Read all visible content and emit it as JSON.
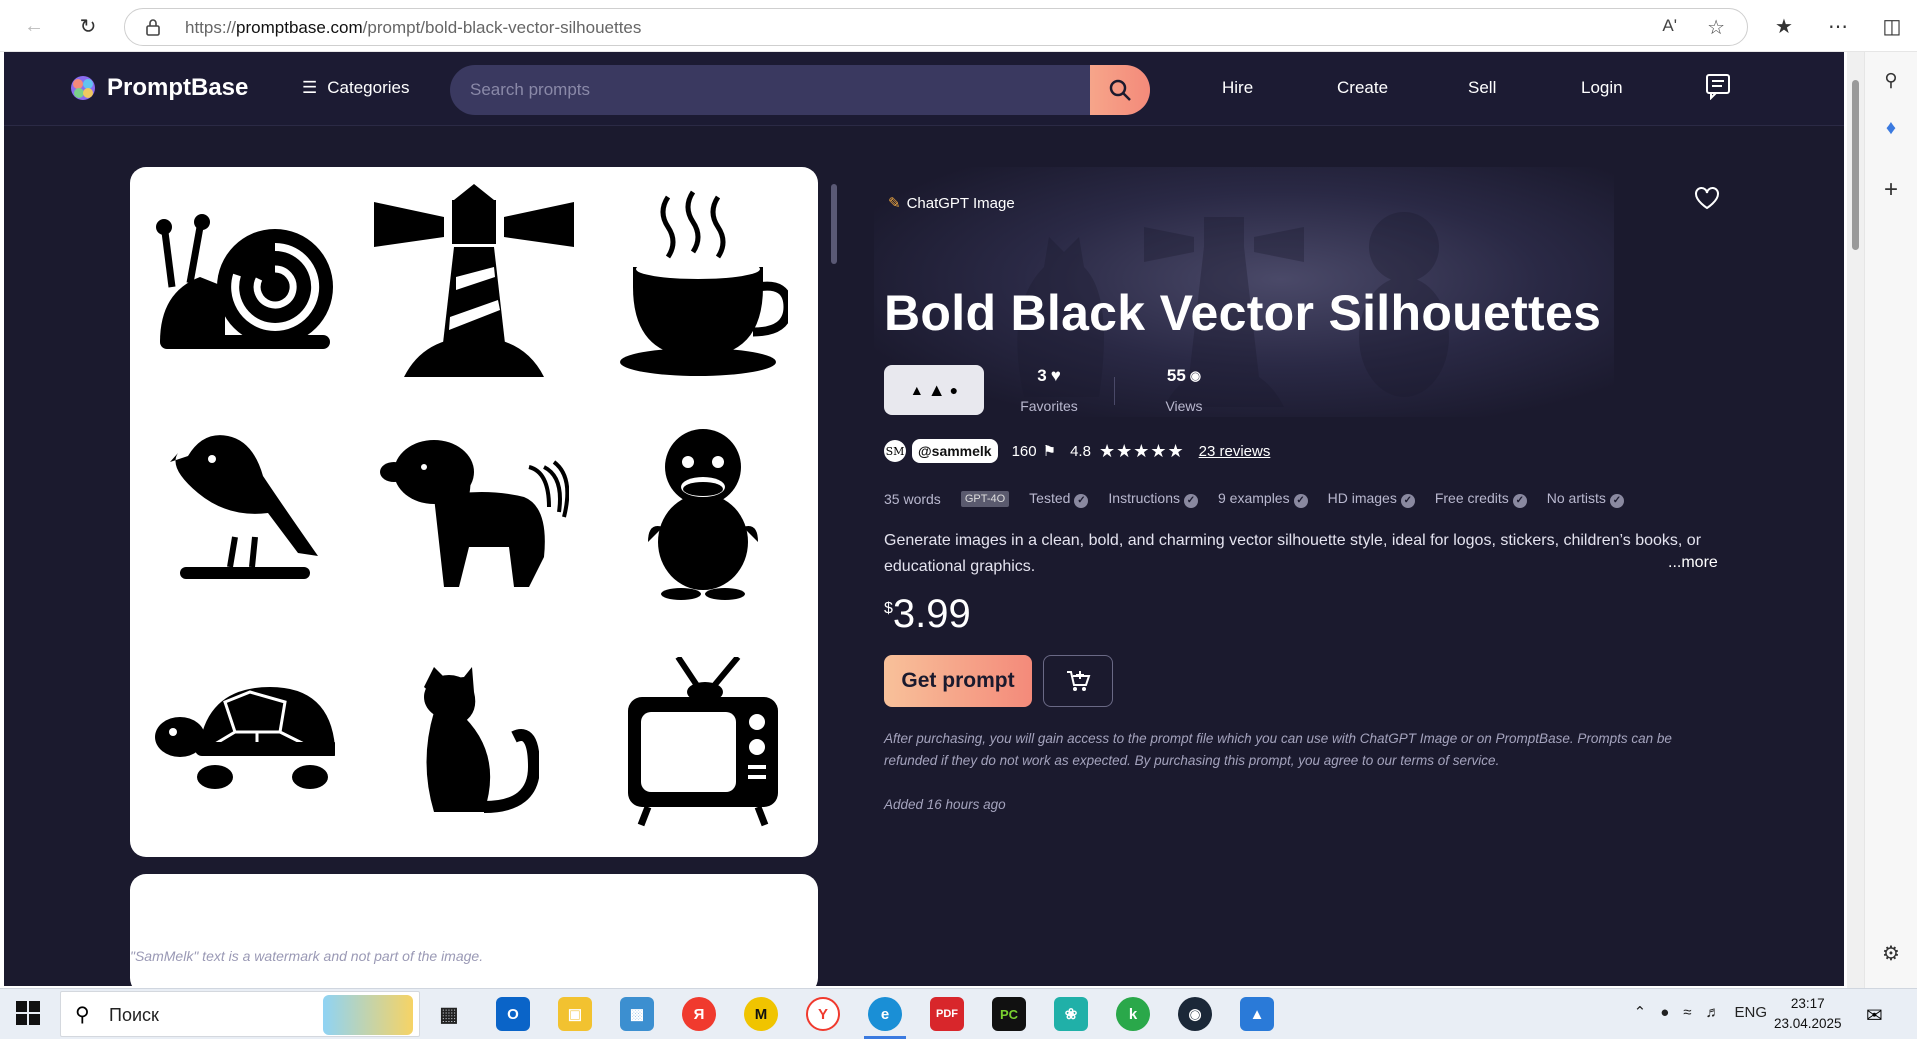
{
  "browser": {
    "url_prefix": "https://",
    "url_domain": "promptbase.com",
    "url_path": "/prompt/bold-black-vector-silhouettes",
    "read_aloud": "Aʹ"
  },
  "nav": {
    "logo_text": "PromptBase",
    "categories_label": "Categories",
    "search_placeholder": "Search prompts",
    "links": [
      "Hire",
      "Create",
      "Sell",
      "Login"
    ]
  },
  "prompt": {
    "model_badge": "ChatGPT Image",
    "title": "Bold Black Vector Silhouettes",
    "favorites_count": "3",
    "favorites_label": "Favorites",
    "views_count": "55",
    "views_label": "Views",
    "author_handle": "@sammelk",
    "author_initials": "SM",
    "author_sales": "160",
    "rating": "4.8",
    "stars": "★★★★★",
    "reviews_link": "23 reviews",
    "meta": {
      "words": "35 words",
      "model_chip": "GPT-4O",
      "tested": "Tested",
      "instructions": "Instructions",
      "examples": "9 examples",
      "hd": "HD images",
      "credits": "Free credits",
      "artists": "No artists"
    },
    "description": "Generate images in a clean, bold, and charming vector silhouette style, ideal for logos, stickers, children’s books, or educational graphics.",
    "more_link": "...more",
    "price_currency": "$",
    "price_value": "3.99",
    "get_button": "Get prompt",
    "terms": "After purchasing, you will gain access to the prompt file which you can use with ChatGPT Image or on PromptBase. Prompts can be refunded if they do not work as expected. By purchasing this prompt, you agree to our terms of service.",
    "added": "Added 16 hours ago",
    "watermark_note": "\"SamMelk\" text is a watermark and not part of the image."
  },
  "gallery_icons": [
    "snail-icon",
    "lighthouse-icon",
    "coffee-cup-icon",
    "bird-icon",
    "dog-icon",
    "duckling-icon",
    "turtle-icon",
    "cat-icon",
    "television-icon"
  ],
  "taskbar": {
    "search_placeholder": "Поиск",
    "lang": "ENG",
    "time": "23:17",
    "date": "23.04.2025"
  },
  "colors": {
    "site_bg": "#1b1a2e",
    "accent_gradient_start": "#f8c19a",
    "accent_gradient_end": "#f48a7a"
  }
}
